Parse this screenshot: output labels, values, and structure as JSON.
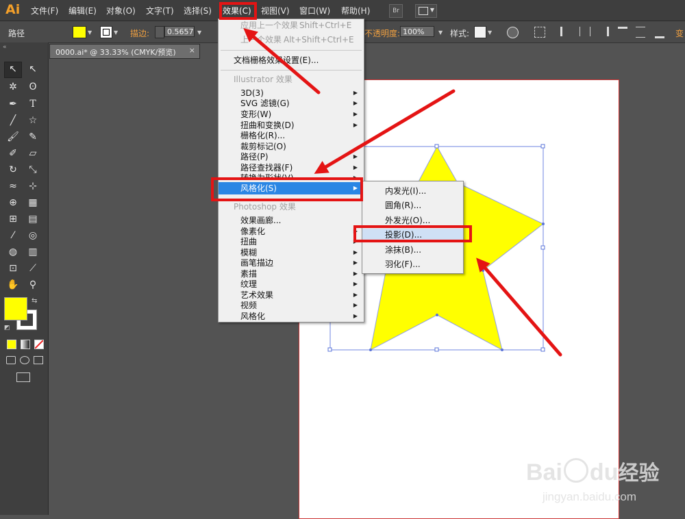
{
  "app": {
    "logo": "Ai"
  },
  "menubar": {
    "items": [
      "文件(F)",
      "编辑(E)",
      "对象(O)",
      "文字(T)",
      "选择(S)",
      "效果(C)",
      "视图(V)",
      "窗口(W)",
      "帮助(H)"
    ],
    "bridge_label": "Br"
  },
  "control_bar": {
    "object_type": "路径",
    "stroke_label": "描边:",
    "stroke_value": "0.5657",
    "opacity_label": "不透明度:",
    "opacity_value": "100%",
    "style_label": "样式:",
    "transform_label": "变"
  },
  "document": {
    "tab_title": "0000.ai* @ 33.33% (CMYK/预览)",
    "close_glyph": "×"
  },
  "effects_menu": {
    "apply_last": "应用上一个效果",
    "apply_last_shortcut": "Shift+Ctrl+E",
    "last_effect": "上一个效果",
    "last_effect_shortcut": "Alt+Shift+Ctrl+E",
    "raster_settings": "文档栅格效果设置(E)...",
    "illustrator_header": "Illustrator 效果",
    "illustrator_items": [
      "3D(3)",
      "SVG 滤镜(G)",
      "变形(W)",
      "扭曲和变换(D)",
      "栅格化(R)...",
      "裁剪标记(O)",
      "路径(P)",
      "路径查找器(F)",
      "转换为形状(V)",
      "风格化(S)"
    ],
    "photoshop_header": "Photoshop 效果",
    "photoshop_items": [
      "效果画廊...",
      "像素化",
      "扭曲",
      "模糊",
      "画笔描边",
      "素描",
      "纹理",
      "艺术效果",
      "视频",
      "风格化"
    ]
  },
  "stylize_submenu": {
    "items": [
      "内发光(I)...",
      "圆角(R)...",
      "外发光(O)...",
      "投影(D)...",
      "涂抹(B)...",
      "羽化(F)..."
    ]
  },
  "watermark": {
    "logo_text": "Bai",
    "logo_du": "du",
    "logo_cn": "经验",
    "url": "jingyan.baidu.com"
  },
  "colors": {
    "fill": "#ffff00",
    "accent_menu": "#2b86e4",
    "annotation_red": "#e41414",
    "logo_orange": "#f4a02a"
  }
}
